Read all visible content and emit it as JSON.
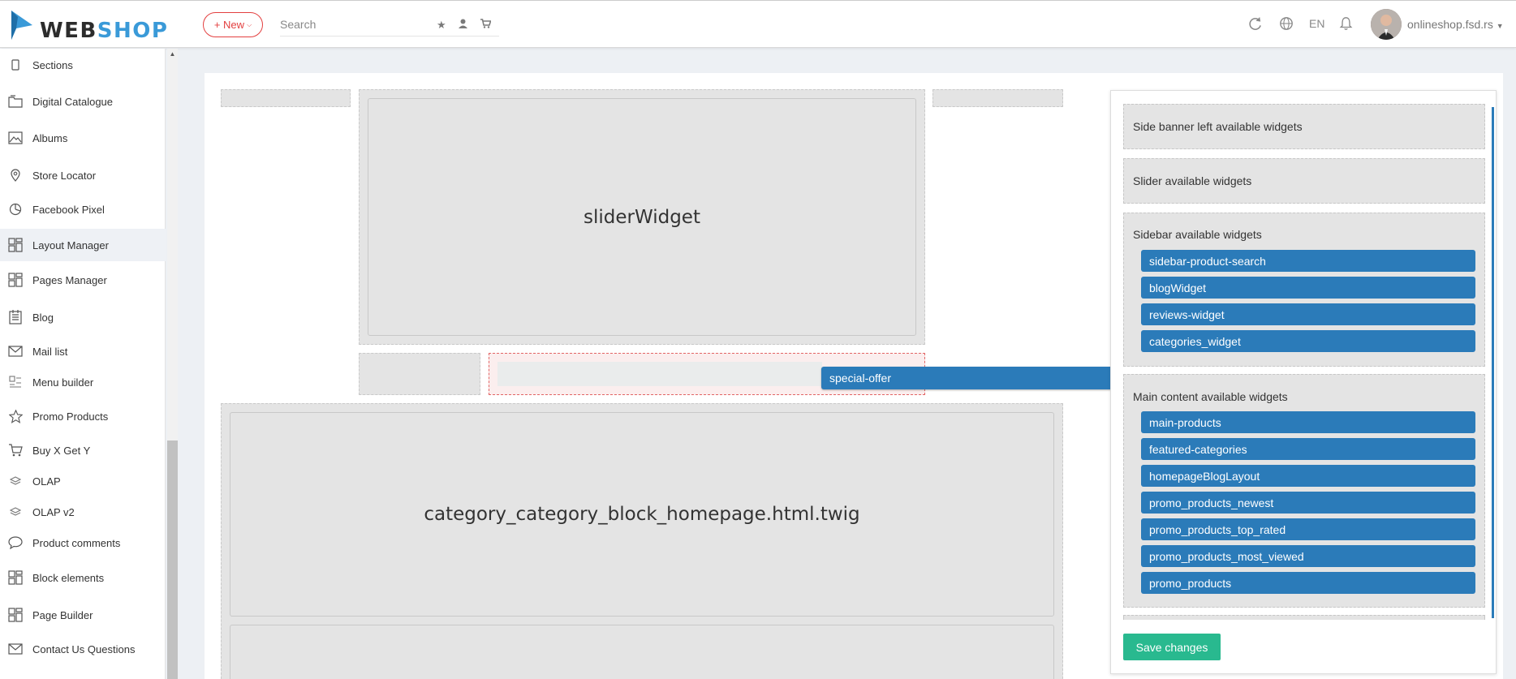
{
  "app": {
    "logo_part1": "WEB",
    "logo_part2": "SHOP",
    "new_button_label": "+ New",
    "search_placeholder": "Search",
    "language": "EN",
    "username": "onlineshop.fsd.rs"
  },
  "colors": {
    "brand_blue": "#3a9ad8",
    "widget_blue": "#2b7bb9",
    "save_green": "#29b98f",
    "new_red": "#e33f3f"
  },
  "sidebar": {
    "items": [
      {
        "label": "Sections",
        "icon": "tablet-icon"
      },
      {
        "label": "Digital Catalogue",
        "icon": "catalogue-icon"
      },
      {
        "label": "Albums",
        "icon": "image-icon"
      },
      {
        "label": "Store Locator",
        "icon": "map-pin-icon"
      },
      {
        "label": "Facebook Pixel",
        "icon": "pie-chart-icon"
      },
      {
        "label": "Layout Manager",
        "icon": "layout-icon",
        "active": true
      },
      {
        "label": "Pages Manager",
        "icon": "layout-icon"
      },
      {
        "label": "Blog",
        "icon": "blog-icon"
      },
      {
        "label": "Mail list",
        "icon": "mail-icon"
      },
      {
        "label": "Menu builder",
        "icon": "menu-builder-icon"
      },
      {
        "label": "Promo Products",
        "icon": "star-icon"
      },
      {
        "label": "Buy X Get Y",
        "icon": "cart-icon"
      },
      {
        "label": "OLAP",
        "icon": "layers-icon"
      },
      {
        "label": "OLAP v2",
        "icon": "layers-icon"
      },
      {
        "label": "Product comments",
        "icon": "comment-icon"
      },
      {
        "label": "Block elements",
        "icon": "layout-icon"
      },
      {
        "label": "Page Builder",
        "icon": "layout-icon"
      },
      {
        "label": "Contact Us Questions",
        "icon": "mail-icon"
      }
    ]
  },
  "layout": {
    "slider_widget": "sliderWidget",
    "category_block": "category_category_block_homepage.html.twig",
    "dragging_widget": "special-offer"
  },
  "widgets_panel": {
    "groups": [
      {
        "title": "Side banner left available widgets",
        "widgets": []
      },
      {
        "title": "Slider available widgets",
        "widgets": []
      },
      {
        "title": "Sidebar available widgets",
        "widgets": [
          "sidebar-product-search",
          "blogWidget",
          "reviews-widget",
          "categories_widget"
        ]
      },
      {
        "title": "Main content available widgets",
        "widgets": [
          "main-products",
          "featured-categories",
          "homepageBlogLayout",
          "promo_products_newest",
          "promo_products_top_rated",
          "promo_products_most_viewed",
          "promo_products"
        ]
      }
    ],
    "save_label": "Save changes"
  }
}
